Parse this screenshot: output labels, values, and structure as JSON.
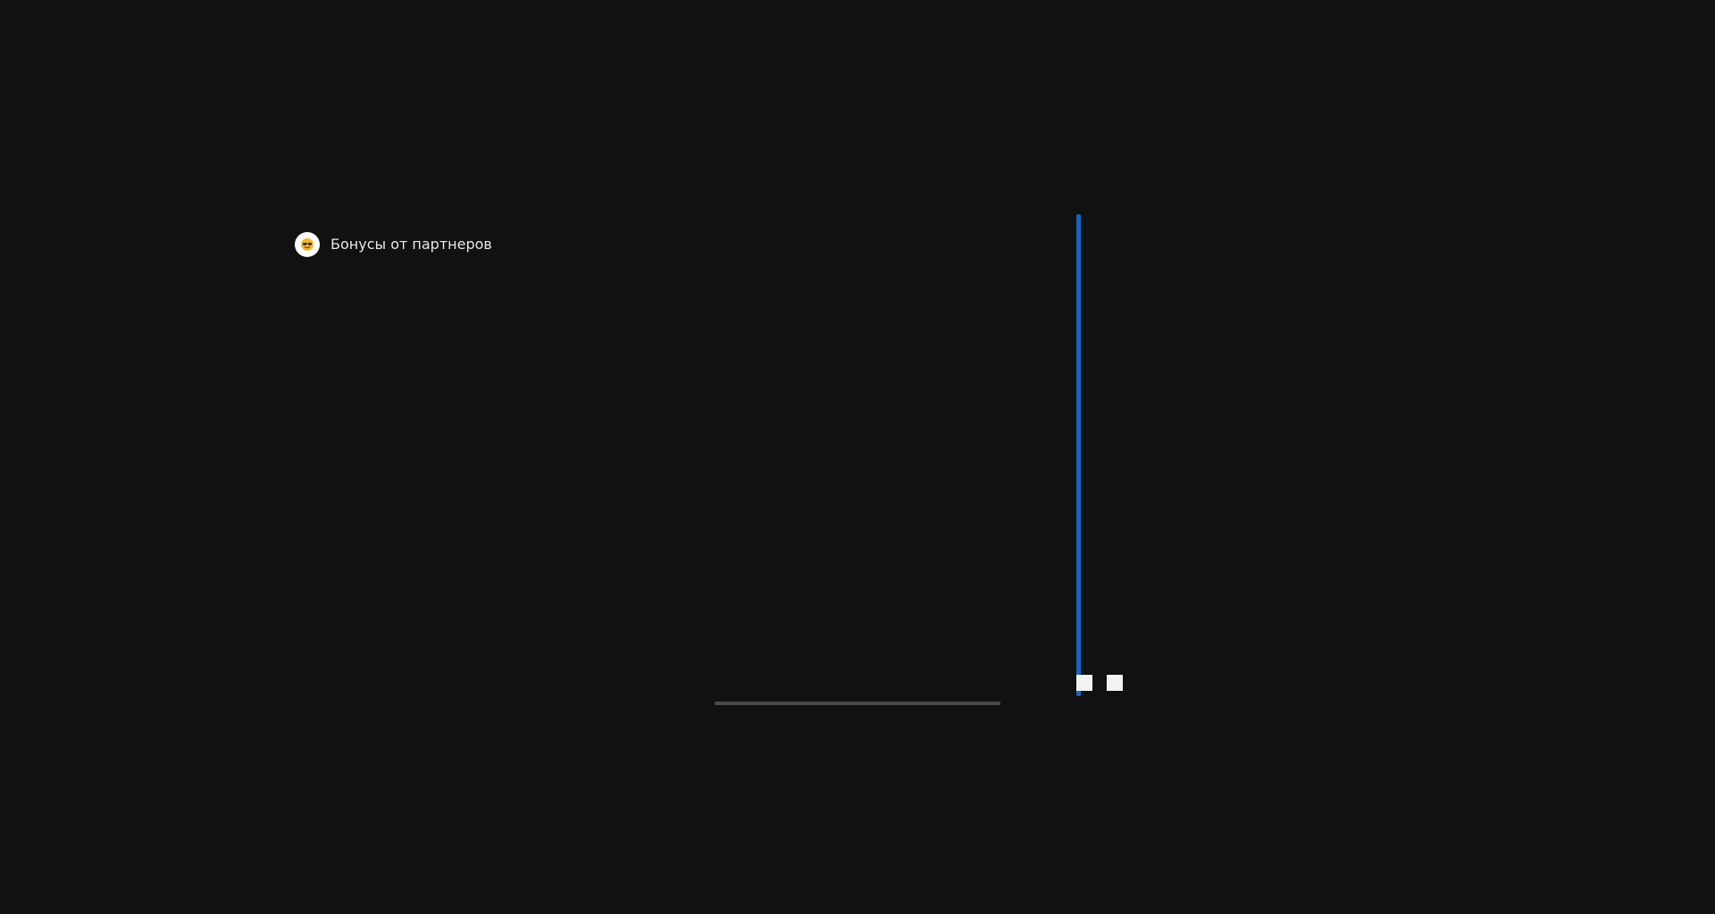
{
  "partner_item": {
    "label": "Бонусы от партнеров",
    "icon": "sunglasses-face-icon"
  },
  "colors": {
    "background": "#111111",
    "accent": "#1565c0",
    "text": "#e8e8e8",
    "scrollbar": "#4a4a4a",
    "square": "#f2f2f2"
  }
}
